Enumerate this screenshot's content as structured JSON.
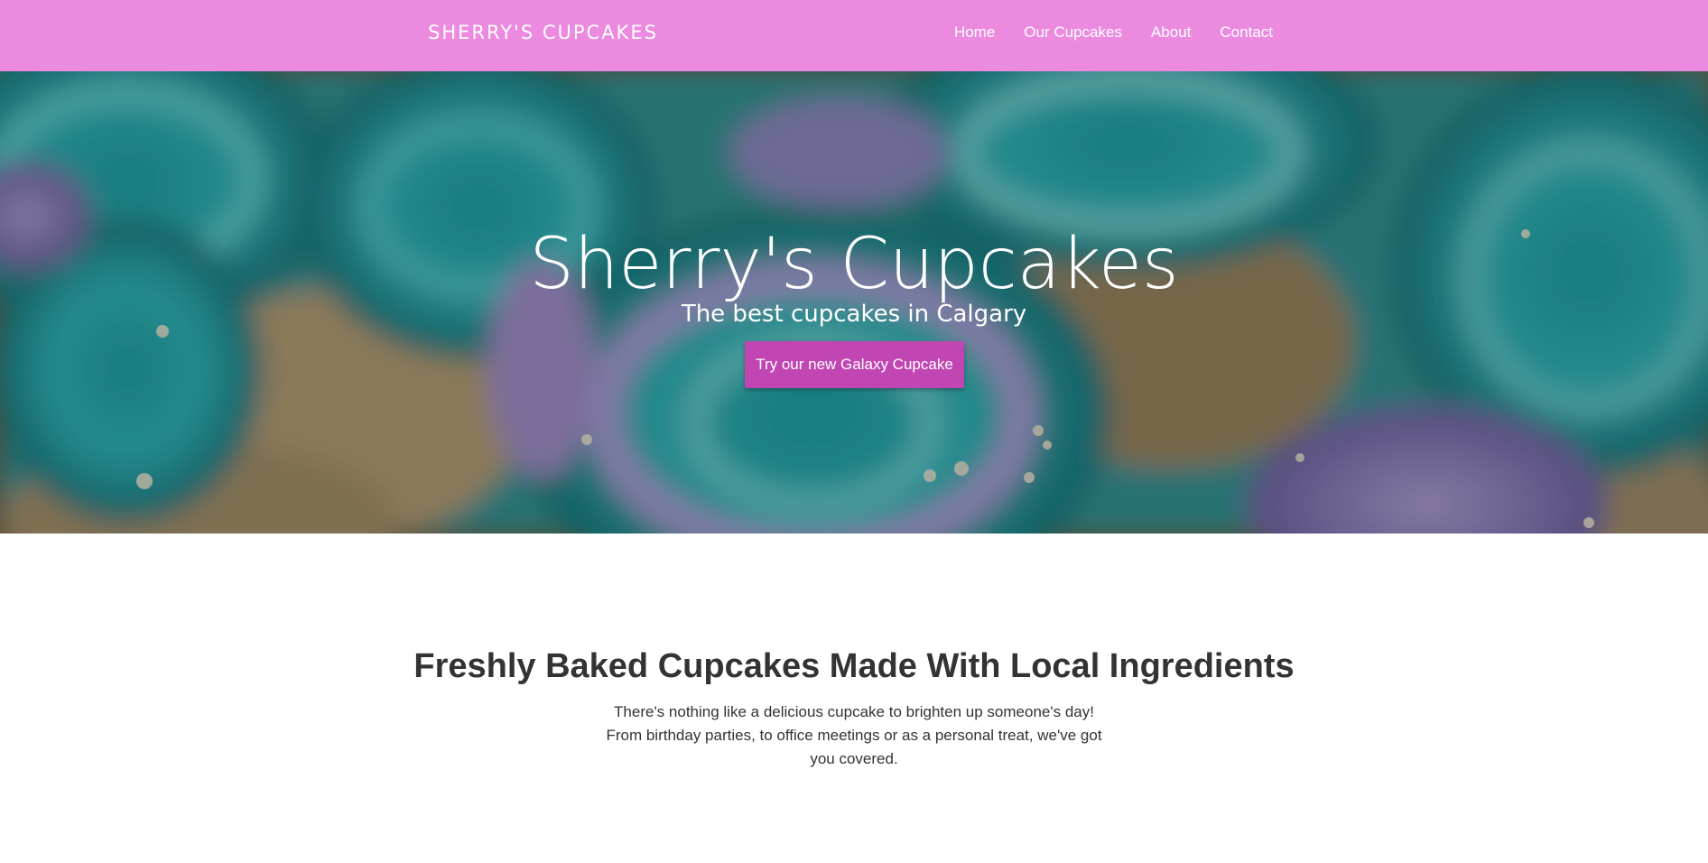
{
  "navbar": {
    "brand": "SHERRY'S CUPCAKES",
    "background_color": "#ec8ae0",
    "links": [
      {
        "label": "Home"
      },
      {
        "label": "Our Cupcakes"
      },
      {
        "label": "About"
      },
      {
        "label": "Contact"
      }
    ]
  },
  "hero": {
    "title": "Sherry's Cupcakes",
    "subtitle": "The best cupcakes in Calgary",
    "cta_label": "Try our new Galaxy Cupcake",
    "cta_color": "#c146b4"
  },
  "intro": {
    "heading": "Freshly Baked Cupcakes Made With Local Ingredients",
    "lines": [
      "There's nothing like a delicious cupcake to brighten up someone's day!",
      "From birthday parties, to office meetings or as a personal treat, we've got you covered."
    ]
  }
}
